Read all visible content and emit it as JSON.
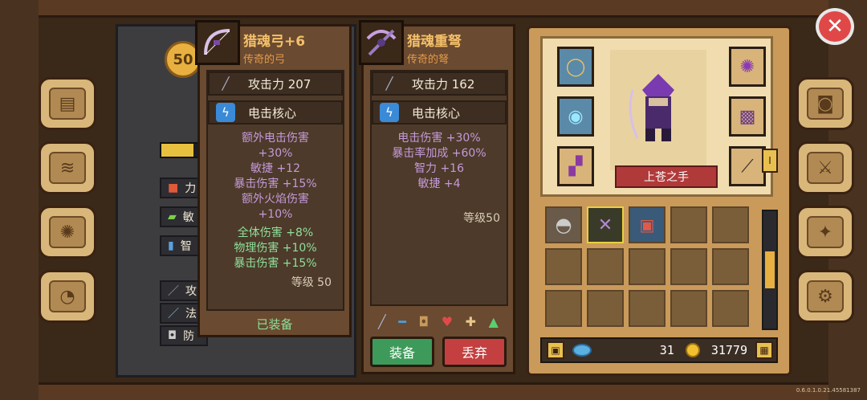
{
  "item_left": {
    "name": "猎魂弓+6",
    "rarity": "传奇的弓",
    "attack_label": "攻击力 207",
    "core_label": "电击核心",
    "stats_purple": [
      "额外电击伤害",
      "+30%",
      "敏捷 +12",
      "暴击伤害 +15%",
      "额外火焰伤害",
      "+10%"
    ],
    "stats_green": [
      "全体伤害 +8%",
      "物理伤害 +10%",
      "暴击伤害 +15%"
    ],
    "level": "等级 50",
    "equipped_label": "已装备"
  },
  "item_right": {
    "name": "猎魂重弩",
    "rarity": "传奇的弩",
    "attack_label": "攻击力 162",
    "core_label": "电击核心",
    "stats_purple": [
      "电击伤害 +30%",
      "暴击率加成 +60%",
      "智力 +16",
      "敏捷 +4"
    ],
    "level": "等级50",
    "equip_button": "装备",
    "discard_button": "丢弃"
  },
  "character": {
    "title": "上苍之手"
  },
  "currency": {
    "gems": "31",
    "gold": "31779"
  },
  "left_panel": {
    "level_badge": "50",
    "labels": [
      "力",
      "敏",
      "智",
      "攻",
      "法",
      "防"
    ]
  },
  "version": "0.6.0.1.0.21.45581387",
  "colors": {
    "gold": "#f4c06a",
    "legend_orange": "#e49a4a",
    "purple_stat": "#c49ad8",
    "green_stat": "#8ee09a",
    "equip_btn": "#3e9a5a",
    "discard_btn": "#c44040"
  }
}
